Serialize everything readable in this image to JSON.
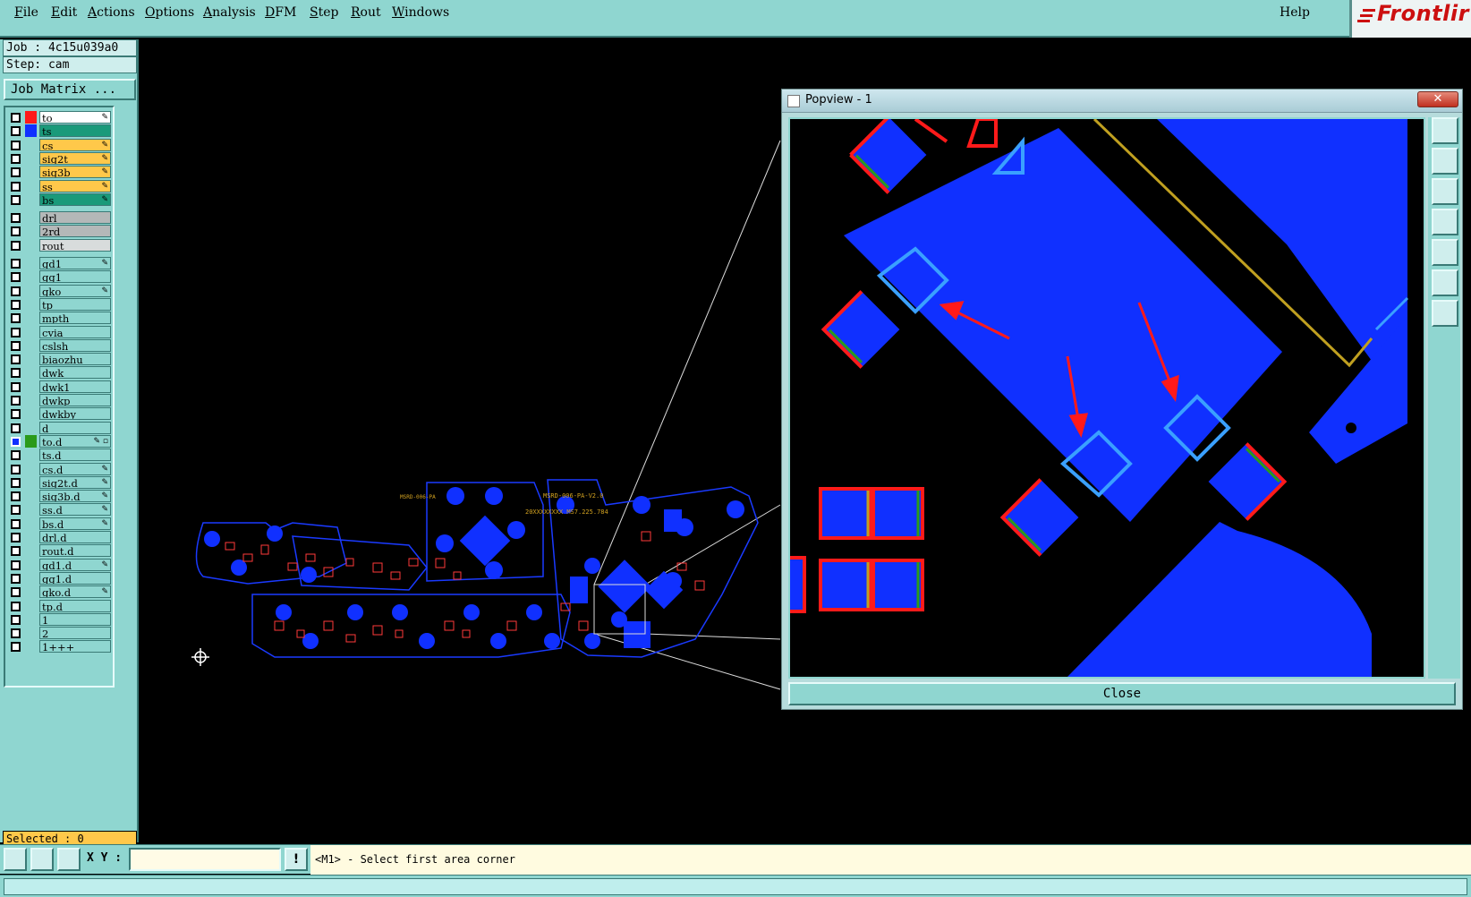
{
  "menu": {
    "items": [
      {
        "label": "File",
        "underline": "F",
        "rest": "ile"
      },
      {
        "label": "Edit",
        "underline": "E",
        "rest": "dit"
      },
      {
        "label": "Actions",
        "underline": "A",
        "rest": "ctions"
      },
      {
        "label": "Options",
        "underline": "O",
        "rest": "ptions"
      },
      {
        "label": "Analysis",
        "underline": "A",
        "rest": "nalysis"
      },
      {
        "label": "DFM",
        "underline": "D",
        "rest": "FM"
      },
      {
        "label": "Step",
        "underline": "S",
        "rest": "tep"
      },
      {
        "label": "Rout",
        "underline": "R",
        "rest": "out"
      },
      {
        "label": "Windows",
        "underline": "W",
        "rest": "indows"
      }
    ],
    "help": "Help",
    "logo": "Frontlir"
  },
  "job": {
    "job_line": "Job : 4c15u039a0",
    "step_line": "Step: cam",
    "matrix_button": "Job Matrix ..."
  },
  "layers": [
    {
      "name": "to",
      "swatch": "#ff1a1a",
      "bg": "#ffffff",
      "mark": "✎"
    },
    {
      "name": "ts",
      "swatch": "#1030ff",
      "bg": "#1a9a7a",
      "mark": ""
    },
    {
      "name": "cs",
      "swatch": "",
      "bg": "#ffc84a",
      "mark": "✎"
    },
    {
      "name": "sig2t",
      "swatch": "",
      "bg": "#ffc84a",
      "mark": "✎"
    },
    {
      "name": "sig3b",
      "swatch": "",
      "bg": "#ffc84a",
      "mark": "✎"
    },
    {
      "name": "ss",
      "swatch": "",
      "bg": "#ffc84a",
      "mark": "✎"
    },
    {
      "name": "bs",
      "swatch": "",
      "bg": "#1a9a7a",
      "mark": "✎"
    },
    {
      "name": "drl",
      "swatch": "",
      "bg": "#b4b8b8",
      "mark": ""
    },
    {
      "name": "2rd",
      "swatch": "",
      "bg": "#b4b8b8",
      "mark": ""
    },
    {
      "name": "rout",
      "swatch": "",
      "bg": "#d8dcdc",
      "mark": ""
    },
    {
      "name": "gd1",
      "swatch": "",
      "bg": "#8fd6d0",
      "mark": "✎"
    },
    {
      "name": "gg1",
      "swatch": "",
      "bg": "#8fd6d0",
      "mark": ""
    },
    {
      "name": "gko",
      "swatch": "",
      "bg": "#8fd6d0",
      "mark": "✎"
    },
    {
      "name": "tp",
      "swatch": "",
      "bg": "#8fd6d0",
      "mark": ""
    },
    {
      "name": "mpth",
      "swatch": "",
      "bg": "#8fd6d0",
      "mark": ""
    },
    {
      "name": "cvia",
      "swatch": "",
      "bg": "#8fd6d0",
      "mark": ""
    },
    {
      "name": "cslsh",
      "swatch": "",
      "bg": "#8fd6d0",
      "mark": ""
    },
    {
      "name": "biaozhu",
      "swatch": "",
      "bg": "#8fd6d0",
      "mark": ""
    },
    {
      "name": "dwk",
      "swatch": "",
      "bg": "#8fd6d0",
      "mark": ""
    },
    {
      "name": "dwk1",
      "swatch": "",
      "bg": "#8fd6d0",
      "mark": ""
    },
    {
      "name": "dwkp",
      "swatch": "",
      "bg": "#8fd6d0",
      "mark": ""
    },
    {
      "name": "dwkby",
      "swatch": "",
      "bg": "#8fd6d0",
      "mark": ""
    },
    {
      "name": "d",
      "swatch": "",
      "bg": "#8fd6d0",
      "mark": ""
    },
    {
      "name": "to.d",
      "swatch": "#2a9a1a",
      "bg": "#8fd6d0",
      "mark": "✎ ▫",
      "checked": true
    },
    {
      "name": "ts.d",
      "swatch": "",
      "bg": "#8fd6d0",
      "mark": ""
    },
    {
      "name": "cs.d",
      "swatch": "",
      "bg": "#8fd6d0",
      "mark": "✎"
    },
    {
      "name": "sig2t.d",
      "swatch": "",
      "bg": "#8fd6d0",
      "mark": "✎"
    },
    {
      "name": "sig3b.d",
      "swatch": "",
      "bg": "#8fd6d0",
      "mark": "✎"
    },
    {
      "name": "ss.d",
      "swatch": "",
      "bg": "#8fd6d0",
      "mark": "✎"
    },
    {
      "name": "bs.d",
      "swatch": "",
      "bg": "#8fd6d0",
      "mark": "✎"
    },
    {
      "name": "drl.d",
      "swatch": "",
      "bg": "#8fd6d0",
      "mark": ""
    },
    {
      "name": "rout.d",
      "swatch": "",
      "bg": "#8fd6d0",
      "mark": ""
    },
    {
      "name": "gd1.d",
      "swatch": "",
      "bg": "#8fd6d0",
      "mark": "✎"
    },
    {
      "name": "gg1.d",
      "swatch": "",
      "bg": "#8fd6d0",
      "mark": ""
    },
    {
      "name": "gko.d",
      "swatch": "",
      "bg": "#8fd6d0",
      "mark": "✎"
    },
    {
      "name": "tp.d",
      "swatch": "",
      "bg": "#8fd6d0",
      "mark": ""
    },
    {
      "name": "1",
      "swatch": "",
      "bg": "#8fd6d0",
      "mark": ""
    },
    {
      "name": "2",
      "swatch": "",
      "bg": "#8fd6d0",
      "mark": ""
    },
    {
      "name": "1+++",
      "swatch": "",
      "bg": "#8fd6d0",
      "mark": ""
    }
  ],
  "selected": "Selected : 0",
  "popview": {
    "title": "Popview - 1",
    "close_x": "✕",
    "close_button": "Close"
  },
  "board_text": {
    "label1": "MSRD-006-PA-V2.0",
    "label2": "20XXXXXXXX  MS7.225.784"
  },
  "status": {
    "xy_label": "X Y :",
    "xy_value": "",
    "prompt": "<M1> - Select first area corner",
    "warn": "!"
  },
  "colors": {
    "bg_panel": "#8fd6d0",
    "copper": "#1030ff",
    "pad_red": "#ff1a1a",
    "pad_green": "#2a9a1a",
    "highlight": "#3aa0ff",
    "trace_gold": "#c0a020"
  }
}
